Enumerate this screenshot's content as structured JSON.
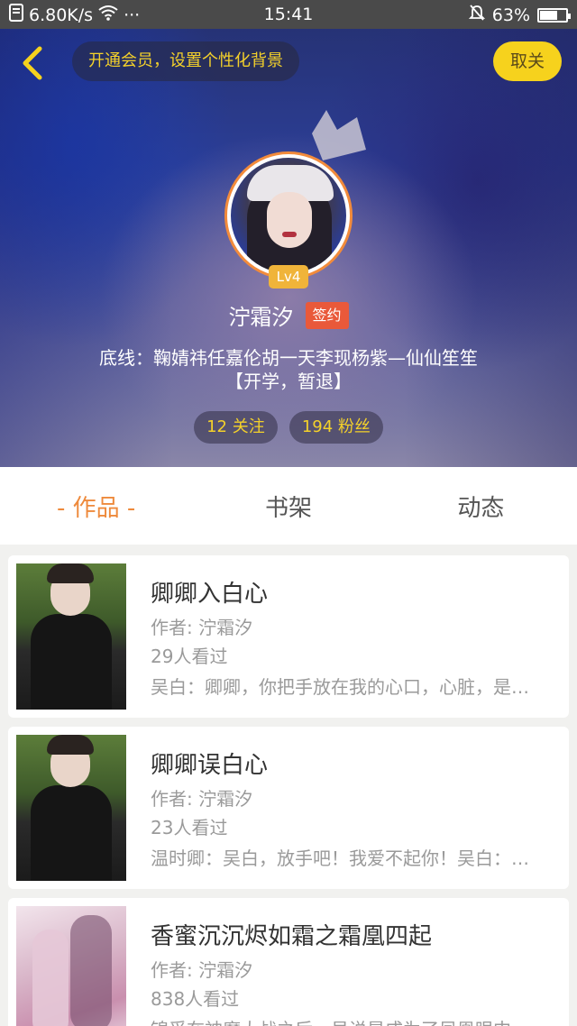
{
  "status_bar": {
    "speed": "6.80K/s",
    "dots": "···",
    "time": "15:41",
    "battery_pct": "63%",
    "battery_level": 0.63
  },
  "header": {
    "vip_prompt": "开通会员，设置个性化背景",
    "unfollow_label": "取关"
  },
  "profile": {
    "level": "Lv4",
    "name": "泞霜汐",
    "signed_badge": "签约",
    "bio_line1": "底线：鞠婧祎任嘉伦胡一天李现杨紫—仙仙笙笙",
    "bio_line2": "【开学，暂退】",
    "following": "12 关注",
    "followers": "194 粉丝"
  },
  "tabs": [
    {
      "label": "- 作品 -",
      "active": true
    },
    {
      "label": "书架",
      "active": false
    },
    {
      "label": "动态",
      "active": false
    }
  ],
  "works": [
    {
      "title": "卿卿入白心",
      "author": "作者: 泞霜汐",
      "views": "29人看过",
      "excerpt": "吴白：卿卿，你把手放在我的心口，心脏，是…",
      "cover": "man-in-black-hoodie"
    },
    {
      "title": "卿卿误白心",
      "author": "作者: 泞霜汐",
      "views": "23人看过",
      "excerpt": "温时卿：吴白，放手吧！我爱不起你！吴白：…",
      "cover": "man-in-black-hoodie"
    },
    {
      "title": "香蜜沉沉烬如霜之霜凰四起",
      "author": "作者: 泞霜汐",
      "views": "838人看过",
      "excerpt": "锦觅在神魔大战之后，虽说是成为了凤凰眼中…",
      "cover": "pink-drama-poster"
    }
  ],
  "colors": {
    "accent_orange": "#ee8a3c",
    "yellow": "#f6d21d",
    "signed_red": "#e9593a",
    "level_gold": "#f0b43a"
  }
}
